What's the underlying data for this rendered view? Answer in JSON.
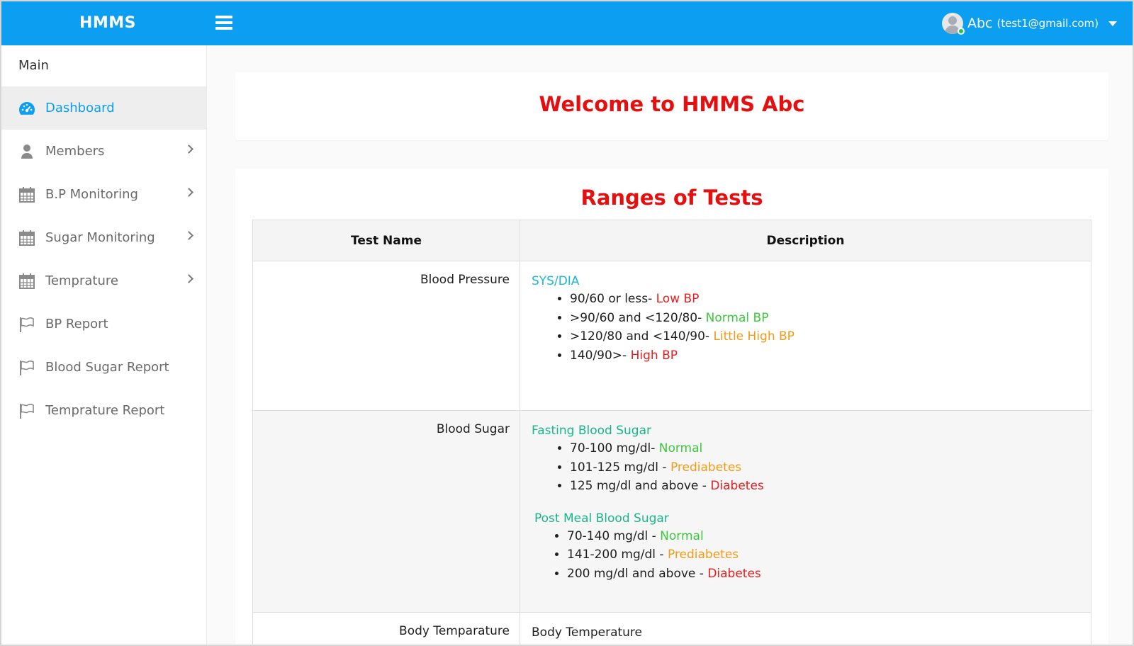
{
  "header": {
    "brand": "HMMS",
    "user_name": "Abc",
    "user_email": "(test1@gmail.com)"
  },
  "sidebar": {
    "title": "Main",
    "items": [
      {
        "label": "Dashboard",
        "icon": "dashboard-gauge-icon",
        "active": true
      },
      {
        "label": "Members",
        "icon": "user-icon",
        "has_submenu": true
      },
      {
        "label": "B.P Monitoring",
        "icon": "calendar-icon",
        "has_submenu": true
      },
      {
        "label": "Sugar Monitoring",
        "icon": "calendar-icon",
        "has_submenu": true
      },
      {
        "label": "Temprature",
        "icon": "calendar-icon",
        "has_submenu": true
      },
      {
        "label": "BP Report",
        "icon": "flag-icon"
      },
      {
        "label": "Blood Sugar Report",
        "icon": "flag-icon"
      },
      {
        "label": "Temprature Report",
        "icon": "flag-icon"
      }
    ]
  },
  "welcome": {
    "title": "Welcome to HMMS Abc"
  },
  "ranges": {
    "title": "Ranges of Tests",
    "columns": [
      "Test Name",
      "Description"
    ],
    "rows": [
      {
        "name": "Blood Pressure",
        "heading": "SYS/DIA",
        "items": [
          {
            "text": "90/60 or less- ",
            "status": "Low BP"
          },
          {
            "text": ">90/60 and <120/80- ",
            "status": "Normal BP"
          },
          {
            "text": ">120/80 and <140/90- ",
            "status": "Little High BP"
          },
          {
            "text": "140/90>- ",
            "status": "High BP"
          }
        ]
      },
      {
        "name": "Blood Sugar",
        "heading": "Fasting Blood Sugar",
        "items": [
          {
            "text": "70-100 mg/dl- ",
            "status": "Normal"
          },
          {
            "text": "101-125 mg/dl - ",
            "status": "Prediabetes"
          },
          {
            "text": "125 mg/dl and above - ",
            "status": "Diabetes"
          }
        ],
        "heading2": "Post Meal Blood Sugar",
        "items2": [
          {
            "text": "70-140 mg/dl - ",
            "status": "Normal"
          },
          {
            "text": "141-200 mg/dl - ",
            "status": "Prediabetes"
          },
          {
            "text": "200 mg/dl and above - ",
            "status": "Diabetes"
          }
        ]
      },
      {
        "name": "Body Temparature",
        "heading": "Body Temperature"
      }
    ]
  },
  "colors": {
    "header_bg": "#0c9ef1",
    "title_red": "#e60f0f",
    "status_red": "#e81d1d",
    "status_green": "#3cc83c",
    "status_orange": "#f39a17",
    "heading_cyan": "#1ab8d1",
    "heading_teal": "#17b68a"
  }
}
